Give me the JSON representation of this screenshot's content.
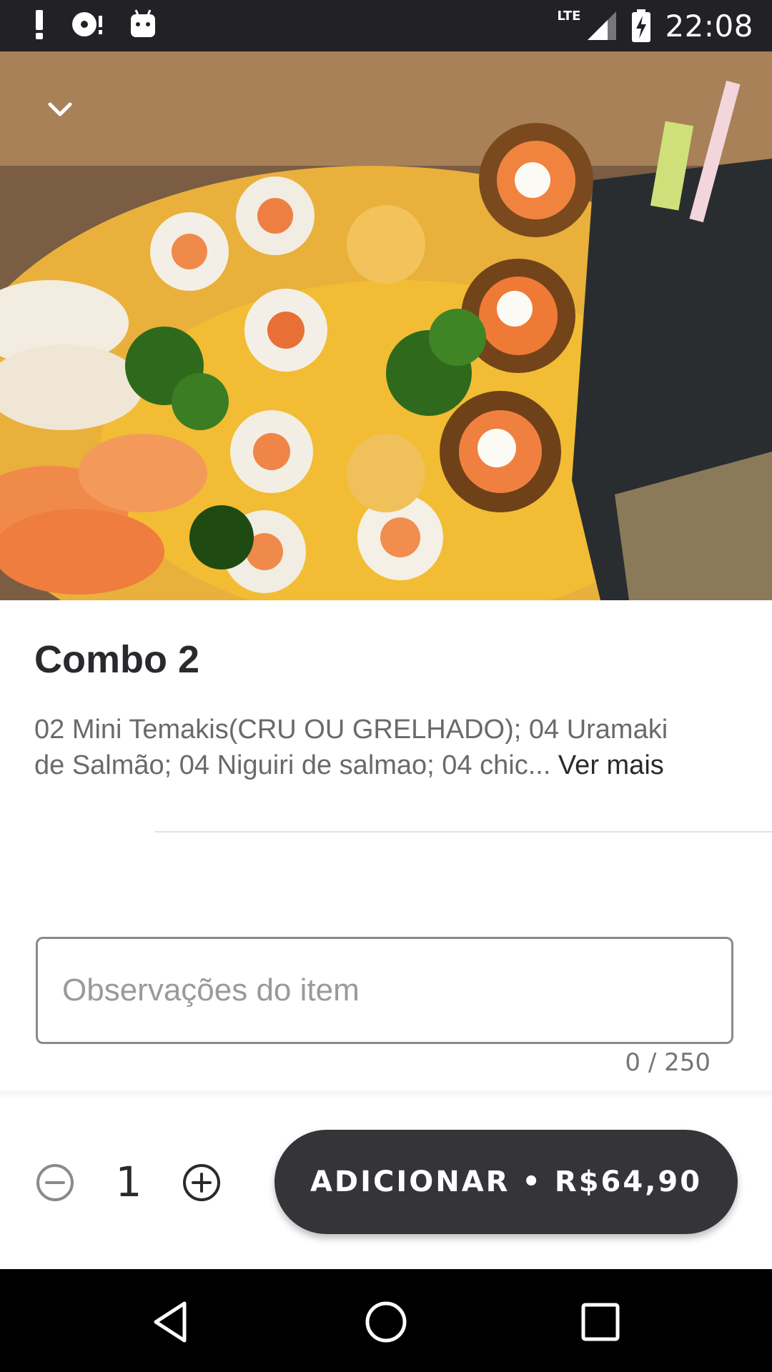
{
  "status_bar": {
    "time": "22:08",
    "network": "LTE",
    "icons": [
      "alert-icon",
      "disc-icon",
      "android-icon",
      "signal-icon",
      "battery-charging-icon"
    ]
  },
  "hero": {
    "image_description_icon": "sushi-combo-photo",
    "collapse_icon": "chevron-down-icon"
  },
  "product": {
    "title": "Combo 2",
    "description_line1": "02 Mini Temakis(CRU OU GRELHADO); 04 Uramaki",
    "description_line2": "de Salmão; 04 Niguiri de salmao; 04 chic...",
    "more_label": " Ver mais"
  },
  "notes": {
    "placeholder": "Observações do item",
    "value": "",
    "counter": "0 / 250"
  },
  "order": {
    "quantity": "1",
    "add_button_label": "ADICIONAR • R$64,90"
  },
  "colors": {
    "status_bar": "#222126",
    "button_bg": "#353438",
    "title_text": "#2a2a2e",
    "nav_bar": "#000000"
  },
  "nav_bar": {
    "icons": [
      "back-icon",
      "home-icon",
      "recents-icon"
    ]
  }
}
